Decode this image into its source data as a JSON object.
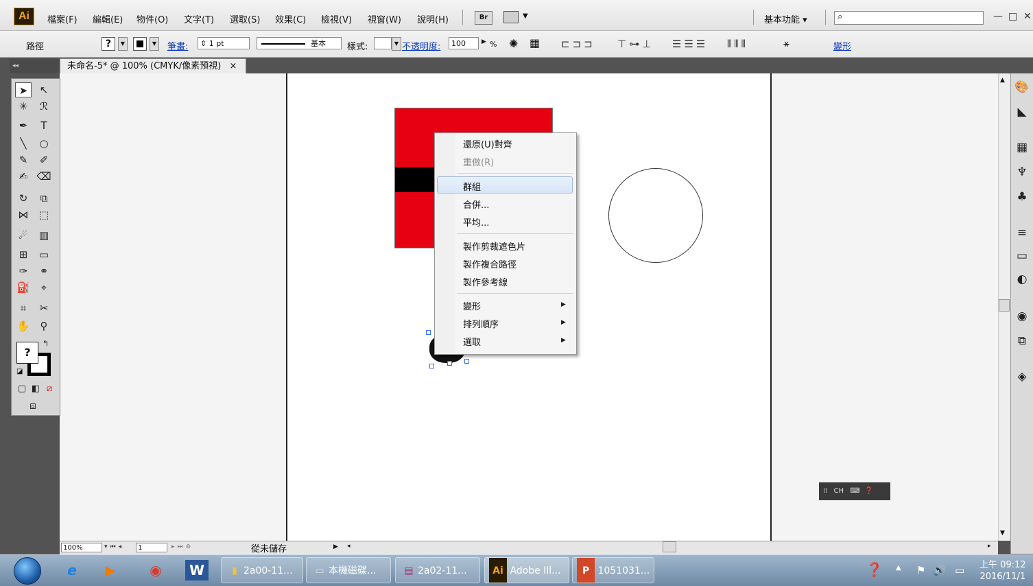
{
  "app": {
    "logo": "Ai"
  },
  "menubar": {
    "items": [
      "檔案(F)",
      "編輯(E)",
      "物件(O)",
      "文字(T)",
      "選取(S)",
      "效果(C)",
      "檢視(V)",
      "視窗(W)",
      "說明(H)"
    ],
    "bridge_label": "Br",
    "workspace": "基本功能 ▾",
    "search_placeholder": "",
    "window_controls": [
      "—",
      "□",
      "✕"
    ]
  },
  "controlbar": {
    "selection_type": "路徑",
    "fill_indicator": "?",
    "stroke_label": "筆畫:",
    "stroke_weight": "1 pt",
    "brush_label": "基本",
    "style_label": "樣式:",
    "opacity_label": "不透明度:",
    "opacity_value": "100",
    "percent": "%",
    "transform_link": "變形"
  },
  "document": {
    "tab_title": "未命名-5* @ 100% (CMYK/像素預視)",
    "tab_close": "×"
  },
  "statusbar": {
    "zoom": "100%",
    "page": "1",
    "status": "從未儲存"
  },
  "toolbox": {
    "fill_stroke_indicator": "?"
  },
  "context_menu": {
    "items": [
      {
        "label": "還原(U)對齊",
        "disabled": false
      },
      {
        "label": "重做(R)",
        "disabled": true
      },
      {
        "label": "群組",
        "disabled": false,
        "highlighted": true
      },
      {
        "label": "合併...",
        "disabled": false
      },
      {
        "label": "平均...",
        "disabled": false
      },
      {
        "label": "製作剪裁遮色片",
        "disabled": false
      },
      {
        "label": "製作複合路徑",
        "disabled": false
      },
      {
        "label": "製作參考線",
        "disabled": false
      },
      {
        "label": "變形",
        "submenu": true
      },
      {
        "label": "排列順序",
        "submenu": true
      },
      {
        "label": "選取",
        "submenu": true
      }
    ]
  },
  "artwork": {
    "red_color": "#e60012",
    "band_color": "#000000"
  },
  "ime_bar": {
    "label": "CH"
  },
  "taskbar": {
    "pinned": [
      "ie-icon",
      "media-player-icon",
      "chrome-icon",
      "word-icon"
    ],
    "buttons": [
      {
        "label": "2a00-11...",
        "icon": "folder-icon"
      },
      {
        "label": "本機磁碟...",
        "icon": "drive-icon"
      },
      {
        "label": "2a02-11...",
        "icon": "winrar-icon"
      },
      {
        "label": "Adobe Ill...",
        "icon": "illustrator-icon"
      },
      {
        "label": "1051031...",
        "icon": "powerpoint-icon"
      }
    ],
    "clock_time": "上午 09:12",
    "clock_date": "2016/11/1"
  }
}
